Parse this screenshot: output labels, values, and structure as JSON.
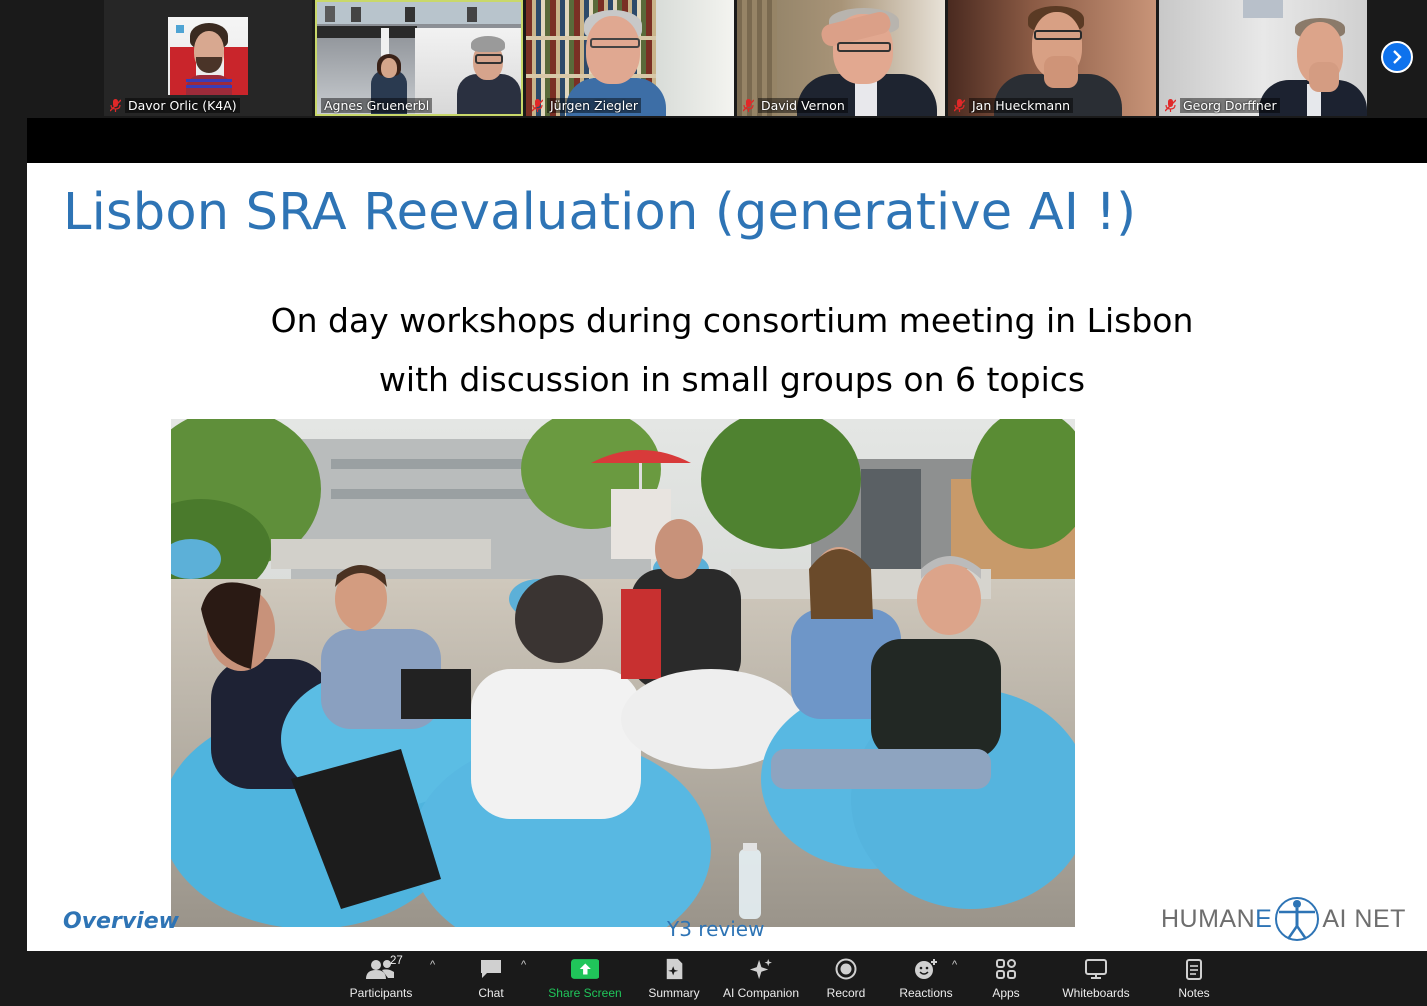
{
  "participants": [
    {
      "name": "Davor Orlic (K4A)",
      "muted": true
    },
    {
      "name": "Agnes Gruenerbl",
      "muted": false,
      "active_speaker": true
    },
    {
      "name": "Jürgen Ziegler",
      "muted": true
    },
    {
      "name": "David Vernon",
      "muted": true
    },
    {
      "name": "Jan Hueckmann",
      "muted": true
    },
    {
      "name": "Georg Dorffner",
      "muted": true
    }
  ],
  "slide": {
    "title": "Lisbon SRA Reevaluation (generative AI !)",
    "subtitle_line1": "On day workshops during consortium meeting in Lisbon",
    "subtitle_line2": "with discussion in small groups on 6 topics",
    "footer_left": "Overview",
    "footer_mid": "Y3 review",
    "logo_part1": "HUMAN",
    "logo_part2": "E",
    "logo_part3": "AI NET"
  },
  "toolbar": {
    "participants_label": "Participants",
    "participants_count": "27",
    "chat_label": "Chat",
    "share_label": "Share Screen",
    "summary_label": "Summary",
    "companion_label": "AI Companion",
    "record_label": "Record",
    "reactions_label": "Reactions",
    "apps_label": "Apps",
    "whiteboards_label": "Whiteboards",
    "notes_label": "Notes",
    "caret": "^"
  },
  "colors": {
    "accent_blue": "#2e74b5",
    "share_green": "#20c55a",
    "zoom_blue": "#0e72ed",
    "muted_red": "#e02828"
  }
}
